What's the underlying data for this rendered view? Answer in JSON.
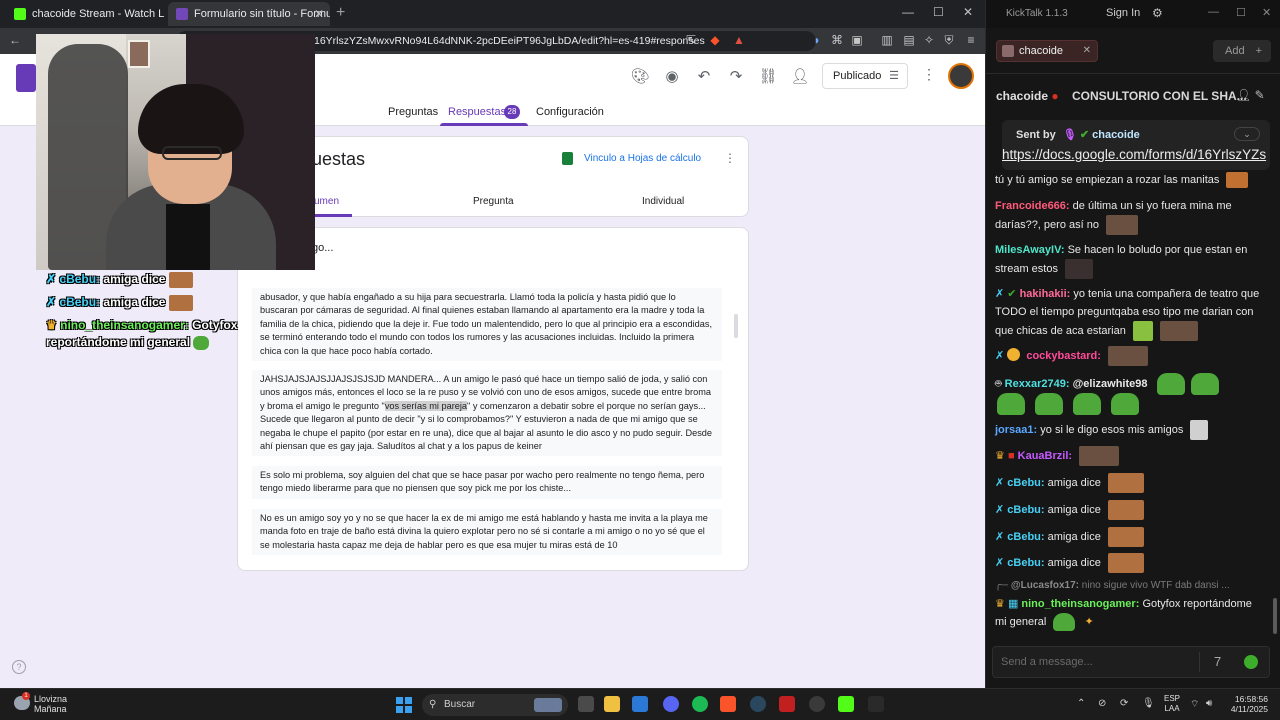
{
  "browser": {
    "tabs": [
      {
        "title": "chacoide Stream - Watch Live on"
      },
      {
        "title": "Formulario sin título - Formulario"
      }
    ],
    "url": "16YrlszYZsMwxvRNo94L64dNNK-2pcDEeiPT96JgLbDA/edit?hl=es-419#responses"
  },
  "forms": {
    "publish_label": "Publicado",
    "tabs": {
      "questions": "Preguntas",
      "responses": "Respuestas",
      "settings": "Configuración"
    },
    "response_count": "28",
    "card_title": "uestas",
    "sheets_link": "Vinculo a Hojas de cálculo",
    "subtabs": {
      "summary": "umen",
      "question": "Pregunta",
      "individual": "Individual"
    },
    "question_title": "go...",
    "responses": [
      "abusador, y que había engañado a su hija para secuestrarla. Llamó toda la policía y hasta pidió que lo buscaran por cámaras de seguridad. Al final quienes estaban llamando al apartamento era la madre y toda la familia de la chica, pidiendo que la deje ir. Fue todo un malentendido, pero lo que al principio era a escondidas, se terminó enterando todo el mundo con todos los rumores y las acusaciones incluidas. Incluido la primera chica con la que hace poco había cortado.",
      "JAHSJAJSJAJSJJAJSJSJSJD MANDERA... A un amigo le pasó qué hace un tiempo salió de joda, y salió con unos amigos más, entonces el loco se la re puso y se volvió con uno de esos amigos, sucede que entre broma y broma el amigo le pregunto \"",
      "vos serías mi pareja",
      "\" y comenzaron a debatir sobre el porque no serían gays... Sucede que llegaron al punto de decir \"y si lo comprobamos?\" Y estuvieron a nada de que mi amigo que se negaba le chupe el papito (por estar en re una), dice que al bajar al asunto le dio asco y no pudo seguir. Desde ahí piensan que es gay jaja. Saludítos al chat y a los papus de keiner",
      "Es solo mi problema, soy alguien del chat que se hace pasar por wacho pero realmente no tengo ñema, pero tengo miedo liberarme para que no piensen que soy pick me por los chiste...",
      "No es un amigo soy yo y no se que hacer la ex de mi amigo me está hablando y hasta me invita a la playa me manda foto en traje de baño está divina la quiero explotar pero no sé si contarle a mi amigo o no yo sé que el se molestaria hasta capaz me deja de hablar pero es que esa mujer tu miras está de 10"
    ]
  },
  "overlay": [
    {
      "user": "cBebu:",
      "text": "amiga dice"
    },
    {
      "user": "cBebu:",
      "text": "amiga dice"
    },
    {
      "user": "nino_theinsanogamer:",
      "text": "Gotyfox",
      "text2": "reportándome mi general"
    }
  ],
  "kicktalk": {
    "app_name": "KickTalk 1.1.3",
    "sign_in": "Sign In",
    "channel": "chacoide",
    "add_label": "Add",
    "pinned_user": "chacoide",
    "pinned_text": "CONSULTORIO CON EL SHA...",
    "sent_by_label": "Sent by",
    "sent_by_user": "chacoide",
    "sent_by_link": "https://docs.google.com/forms/d/16YrlszYZs",
    "messages": [
      {
        "user": "",
        "text": "tú y tú amigo se empiezan a rozar las manitas",
        "color": "#e8e8e8"
      },
      {
        "user": "Francoide666:",
        "text": "de última un si yo fuera mina me darías??, pero así no",
        "color": "#ff5a7a"
      },
      {
        "user": "MilesAwayIV:",
        "text": "Se hacen lo boludo por que estan en stream estos",
        "color": "#4ee6c8"
      },
      {
        "user": "hakihakii:",
        "text": "yo tenia una compañera de teatro que TODO el tiempo preguntqaba eso tipo me darian con que chicas de aca estarian",
        "color": "#ff6a9a"
      },
      {
        "user": "cockybastard:",
        "text": "",
        "color": "#ff4a9a"
      },
      {
        "user": "Rexxar2749:",
        "text": "@elizawhite98",
        "color": "#4ee0e0"
      },
      {
        "user": "jorsaa1:",
        "text": "yo si le digo esos mis amigos",
        "color": "#5aa8ff"
      },
      {
        "user": "KauaBrzil:",
        "text": "",
        "color": "#c55aff"
      },
      {
        "user": "cBebu:",
        "text": "amiga dice",
        "color": "#46d0f5"
      },
      {
        "user": "cBebu:",
        "text": "amiga dice",
        "color": "#46d0f5"
      },
      {
        "user": "cBebu:",
        "text": "amiga dice",
        "color": "#46d0f5"
      },
      {
        "user": "cBebu:",
        "text": "amiga dice",
        "color": "#46d0f5"
      },
      {
        "user": "@Lucasfox17:",
        "text": "nino sigue vivo WTF dab dansi ...",
        "color": "#8a8a8a"
      },
      {
        "user": "nino_theinsanogamer:",
        "text": "Gotyfox reportándome mi general",
        "color": "#6bf05a"
      }
    ],
    "input_placeholder": "Send a message..."
  },
  "taskbar": {
    "weather": "Llovizna",
    "weather_sub": "Mañana",
    "search": "Buscar",
    "lang1": "ESP",
    "lang2": "LAA",
    "time": "16:58:56",
    "date": "4/11/2025"
  }
}
